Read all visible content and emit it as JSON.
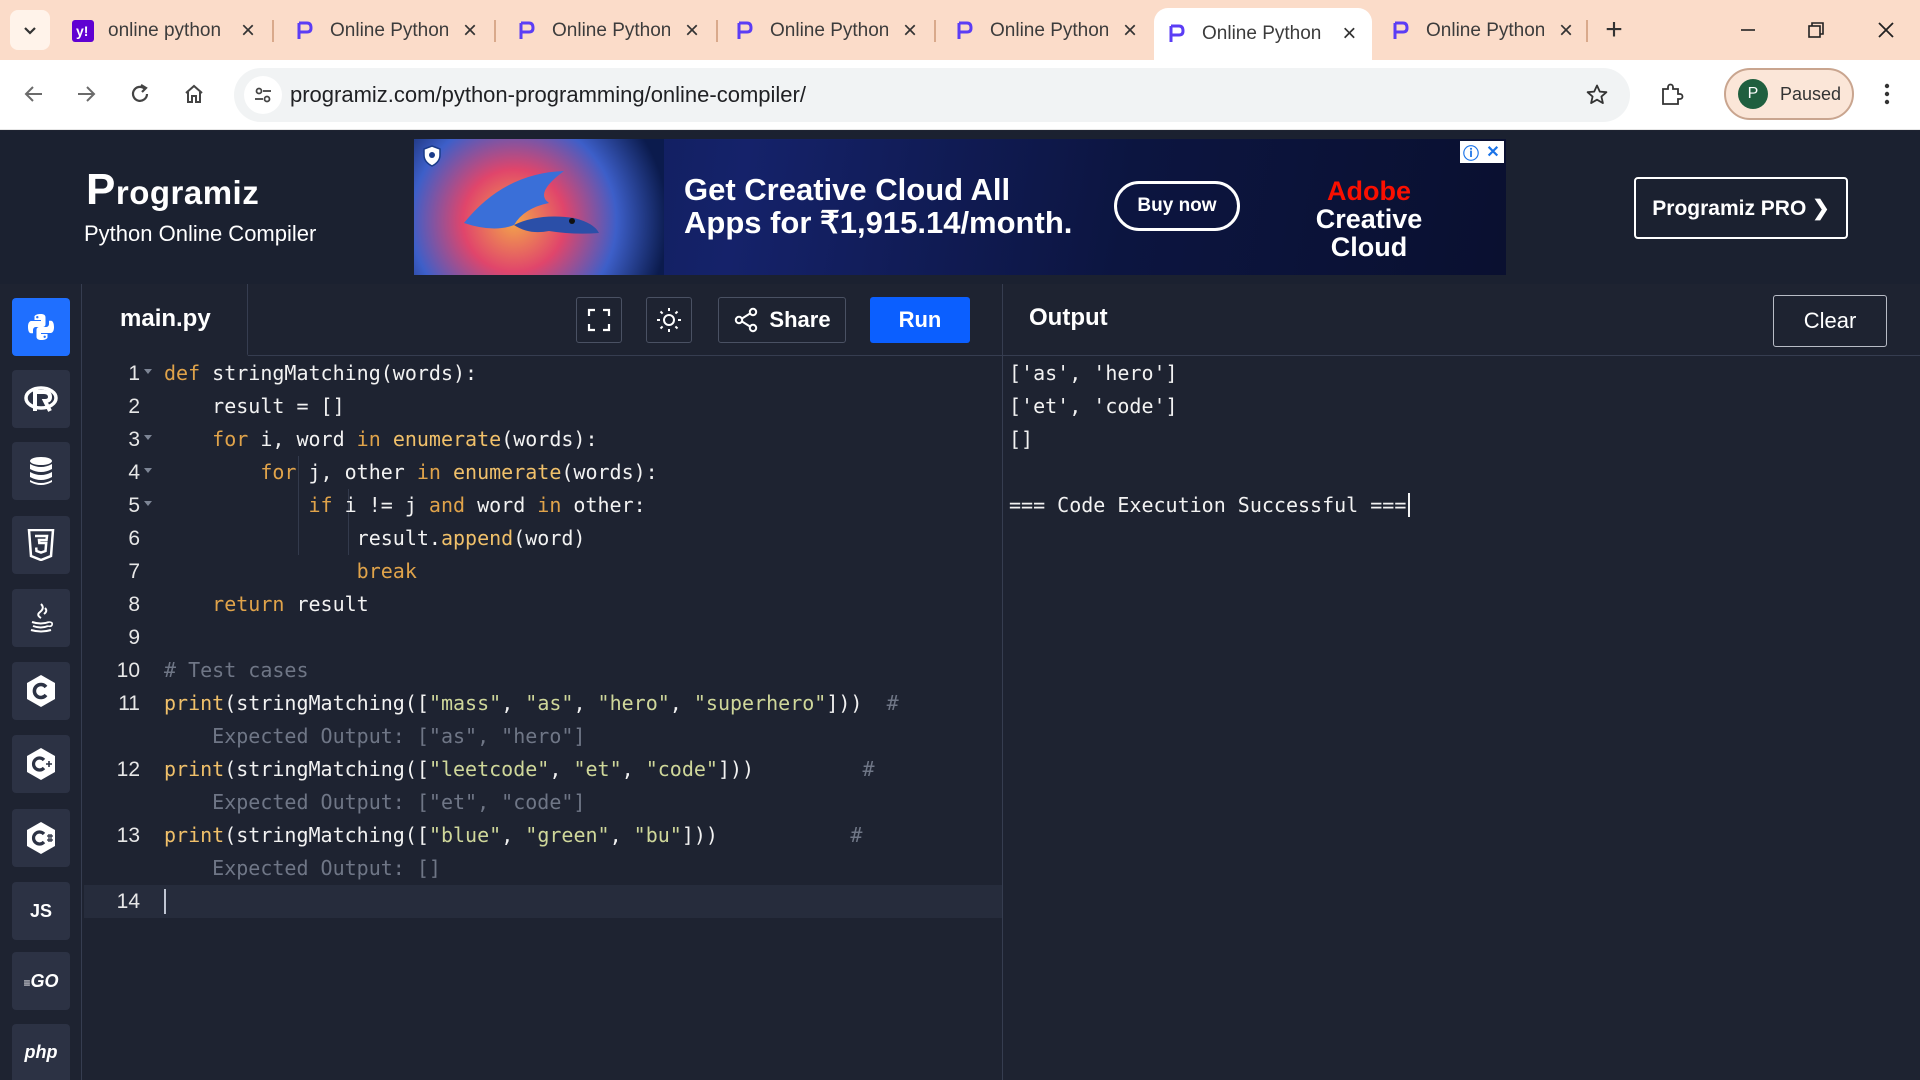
{
  "browser": {
    "tabs": [
      {
        "title": "online python",
        "favicon": "yahoo-icon"
      },
      {
        "title": "Online Python",
        "favicon": "programiz-icon"
      },
      {
        "title": "Online Python",
        "favicon": "programiz-icon"
      },
      {
        "title": "Online Python",
        "favicon": "programiz-icon"
      },
      {
        "title": "Online Python",
        "favicon": "programiz-icon"
      },
      {
        "title": "Online Python",
        "favicon": "programiz-icon",
        "active": true
      },
      {
        "title": "Online Python",
        "favicon": "programiz-icon"
      }
    ],
    "url": "programiz.com/python-programming/online-compiler/",
    "profile": {
      "initial": "P",
      "label": "Paused"
    },
    "colors": {
      "tabstrip": "#fbdcc9",
      "profile_avatar": "#1f5f3f"
    }
  },
  "header": {
    "logo": "rogramiz",
    "logo_initial": "P",
    "subtitle": "Python Online Compiler",
    "pro_button": "Programiz PRO ❯",
    "ad": {
      "headline_1": "Get Creative Cloud All",
      "headline_2": "Apps for ₹1,915.14/month.",
      "button": "Buy now",
      "brand_1": "Adobe",
      "brand_2": "Creative Cloud",
      "info_icon": "ⓘ",
      "close_icon": "✕"
    }
  },
  "sidebar": {
    "languages": [
      {
        "name": "python-icon",
        "active": true
      },
      {
        "name": "r-icon"
      },
      {
        "name": "sql-icon"
      },
      {
        "name": "html-icon"
      },
      {
        "name": "java-icon"
      },
      {
        "name": "c-icon"
      },
      {
        "name": "cpp-icon"
      },
      {
        "name": "csharp-icon"
      },
      {
        "name": "js-icon",
        "text": "JS"
      },
      {
        "name": "go-icon",
        "text": "GO"
      },
      {
        "name": "php-icon",
        "text": "php"
      }
    ]
  },
  "editor": {
    "filename": "main.py",
    "share_label": "Share",
    "run_label": "Run",
    "line_numbers": [
      "1",
      "2",
      "3",
      "4",
      "5",
      "6",
      "7",
      "8",
      "9",
      "10",
      "11",
      "",
      "12",
      "",
      "13",
      "",
      "14"
    ],
    "code": {
      "l1": [
        "def",
        " ",
        "stringMatching",
        "(words):"
      ],
      "l2": "    result = []",
      "l3": [
        "    ",
        "for",
        " i, word ",
        "in",
        " ",
        "enumerate",
        "(words):"
      ],
      "l4": [
        "        ",
        "for",
        " j, other ",
        "in",
        " ",
        "enumerate",
        "(words):"
      ],
      "l5": [
        "            ",
        "if",
        " i != j ",
        "and",
        " word ",
        "in",
        " other:"
      ],
      "l6": [
        "                result.",
        "append",
        "(word)"
      ],
      "l7": [
        "                ",
        "break"
      ],
      "l8": [
        "    ",
        "return",
        " result"
      ],
      "l10": "# Test cases",
      "l11": [
        "print",
        "(",
        "stringMatching",
        "([",
        "\"mass\"",
        ", ",
        "\"as\"",
        ", ",
        "\"hero\"",
        ", ",
        "\"superhero\"",
        "]))  ",
        "#"
      ],
      "l11c": "    Expected Output: [\"as\", \"hero\"]",
      "l12": [
        "print",
        "(",
        "stringMatching",
        "([",
        "\"leetcode\"",
        ", ",
        "\"et\"",
        ", ",
        "\"code\"",
        "]))         ",
        "#"
      ],
      "l12c": "    Expected Output: [\"et\", \"code\"]",
      "l13": [
        "print",
        "(",
        "stringMatching",
        "([",
        "\"blue\"",
        ", ",
        "\"green\"",
        ", ",
        "\"bu\"",
        "]))           ",
        "#"
      ],
      "l13c": "    Expected Output: []"
    }
  },
  "output": {
    "title": "Output",
    "clear_label": "Clear",
    "lines": [
      "['as', 'hero']",
      "['et', 'code']",
      "[]",
      "",
      "=== Code Execution Successful ==="
    ]
  }
}
